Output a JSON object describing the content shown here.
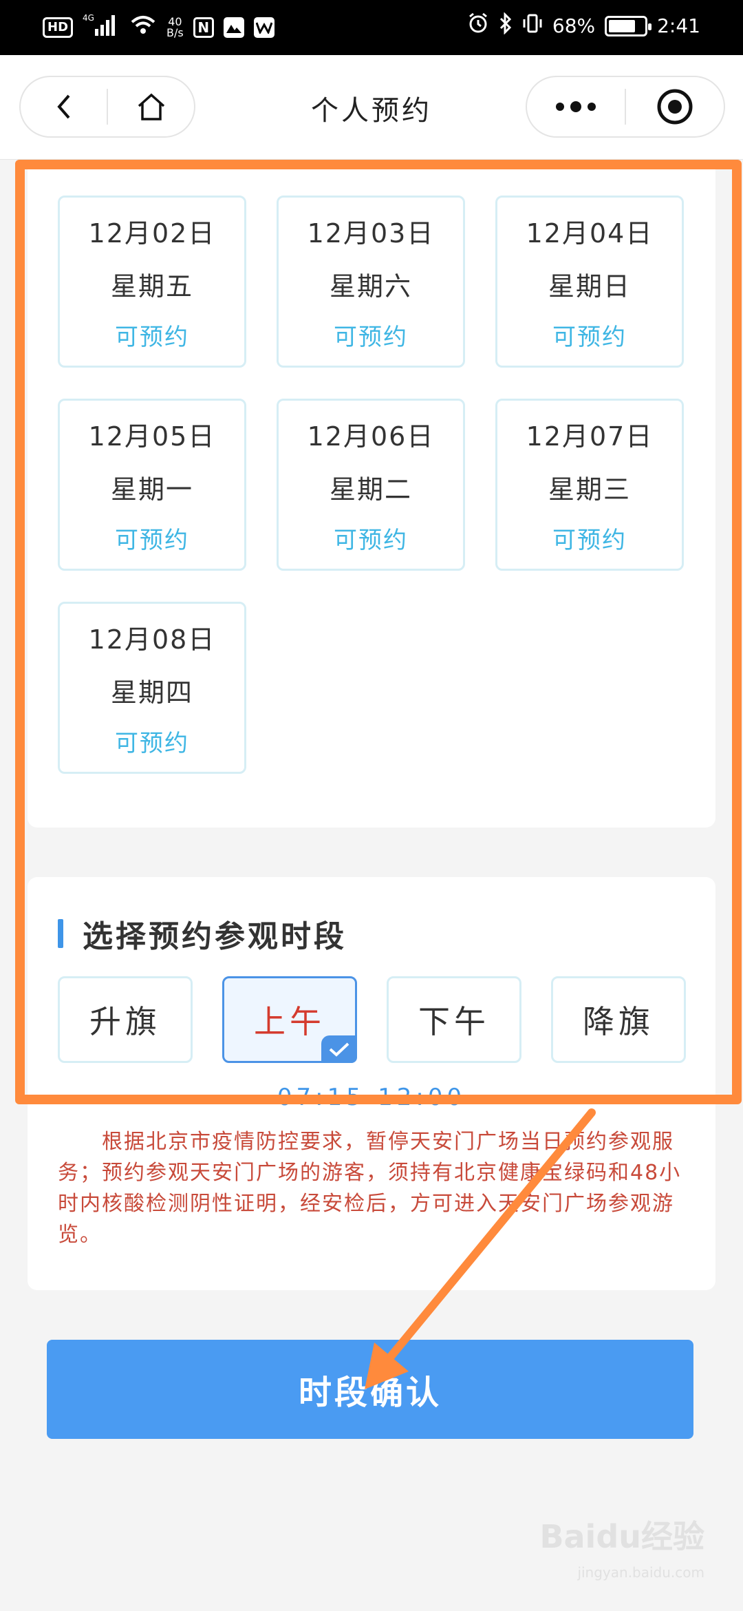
{
  "status_bar": {
    "hd": "HD",
    "network": "4G",
    "speed_value": "40",
    "speed_unit": "B/s",
    "nfc": "N",
    "battery": "68%",
    "time": "2:41"
  },
  "nav": {
    "title": "个人预约"
  },
  "dates": [
    {
      "date": "12月02日",
      "weekday": "星期五",
      "status": "可预约"
    },
    {
      "date": "12月03日",
      "weekday": "星期六",
      "status": "可预约"
    },
    {
      "date": "12月04日",
      "weekday": "星期日",
      "status": "可预约"
    },
    {
      "date": "12月05日",
      "weekday": "星期一",
      "status": "可预约"
    },
    {
      "date": "12月06日",
      "weekday": "星期二",
      "status": "可预约"
    },
    {
      "date": "12月07日",
      "weekday": "星期三",
      "status": "可预约"
    },
    {
      "date": "12月08日",
      "weekday": "星期四",
      "status": "可预约"
    }
  ],
  "time_section": {
    "title": "选择预约参观时段",
    "slots": [
      "升旗",
      "上午",
      "下午",
      "降旗"
    ],
    "selected_slot": "上午",
    "time_range": "07:15-12:00",
    "notice": "根据北京市疫情防控要求，暂停天安门广场当日预约参观服务；预约参观天安门广场的游客，须持有北京健康宝绿码和48小时内核酸检测阴性证明，经安检后，方可进入天安门广场参观游览。"
  },
  "confirm_label": "时段确认",
  "watermark": {
    "text": "Baidu经验",
    "sub": "jingyan.baidu.com"
  },
  "colors": {
    "accent_blue": "#4a9bf2",
    "available_text": "#3fb6e4",
    "selected_text": "#d43b2e",
    "annotation_orange": "#ff8a3c"
  }
}
